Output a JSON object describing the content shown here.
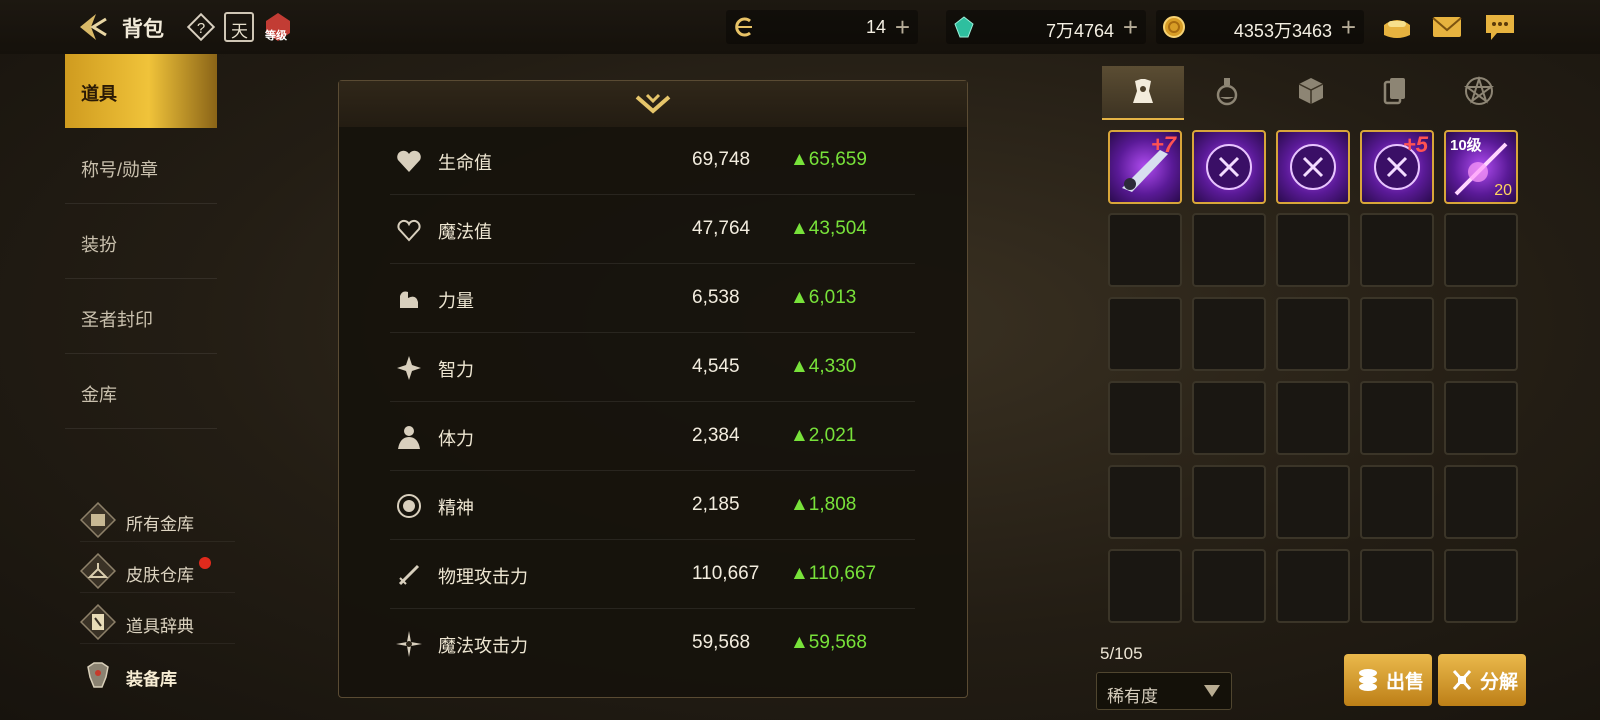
{
  "header": {
    "title": "背包",
    "help_icon": "question-icon",
    "calendar_icon": "calendar-icon",
    "calendar_glyph": "天",
    "level_badge": "等级",
    "currencies": [
      {
        "icon": "ticket-coin-icon",
        "value": "14"
      },
      {
        "icon": "green-gem-icon",
        "value": "7万4764"
      },
      {
        "icon": "gold-coin-icon",
        "value": "4353万3463"
      }
    ],
    "plus": "+",
    "right_icons": [
      "coin-purse-icon",
      "mail-icon",
      "chat-icon"
    ]
  },
  "sidebar": {
    "items": [
      {
        "label": "道具",
        "active": true
      },
      {
        "label": "称号/勋章"
      },
      {
        "label": "装扮"
      },
      {
        "label": "圣者封印"
      },
      {
        "label": "金库"
      }
    ],
    "sub_items": [
      {
        "label": "所有金库",
        "icon": "vault-icon"
      },
      {
        "label": "皮肤仓库",
        "icon": "hanger-icon",
        "badge": "red-dot"
      },
      {
        "label": "道具辞典",
        "icon": "book-icon"
      },
      {
        "label": "装备库",
        "icon": "armor-icon",
        "active": true
      }
    ]
  },
  "stats": {
    "rows": [
      {
        "name": "生命值",
        "icon": "heart-icon",
        "value": "69,748",
        "increase": "▲65,659"
      },
      {
        "name": "魔法值",
        "icon": "heart-outline-icon",
        "value": "47,764",
        "increase": "▲43,504"
      },
      {
        "name": "力量",
        "icon": "muscle-icon",
        "value": "6,538",
        "increase": "▲6,013"
      },
      {
        "name": "智力",
        "icon": "intellect-icon",
        "value": "4,545",
        "increase": "▲4,330"
      },
      {
        "name": "体力",
        "icon": "body-icon",
        "value": "2,384",
        "increase": "▲2,021"
      },
      {
        "name": "精神",
        "icon": "spirit-icon",
        "value": "2,185",
        "increase": "▲1,808"
      },
      {
        "name": "物理攻击力",
        "icon": "sword-icon",
        "value": "110,667",
        "increase": "▲110,667"
      },
      {
        "name": "魔法攻击力",
        "icon": "magic-burst-icon",
        "value": "59,568",
        "increase": "▲59,568"
      }
    ]
  },
  "inventory": {
    "tabs": [
      "equipment-tab-icon",
      "potion-tab-icon",
      "material-tab-icon",
      "cards-tab-icon",
      "pentagram-tab-icon"
    ],
    "items": [
      {
        "type": "weapon",
        "enhance": "+7"
      },
      {
        "type": "orb"
      },
      {
        "type": "orb"
      },
      {
        "type": "orb",
        "enhance": "+5"
      },
      {
        "type": "scroll",
        "level": "10级",
        "count": "20"
      }
    ],
    "capacity": "5/105",
    "sort": "稀有度",
    "sell_label": "出售",
    "disassemble_label": "分解"
  },
  "colors": {
    "accent_gold": "#e9b649",
    "increase_green": "#78e23a",
    "alert_red": "#e02a1c"
  }
}
